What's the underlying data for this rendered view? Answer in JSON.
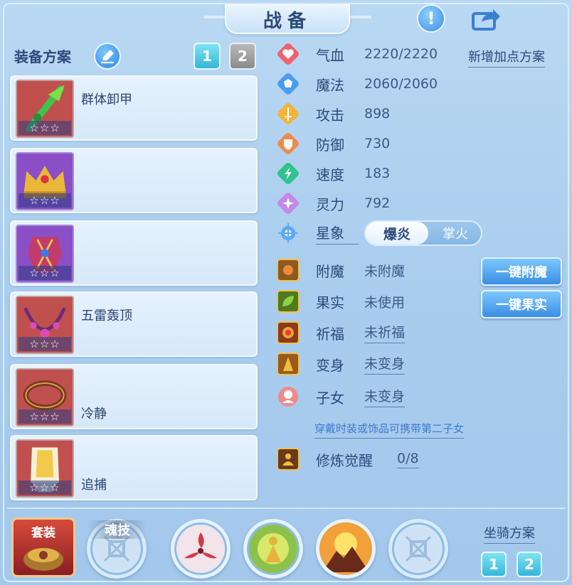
{
  "title": "战备",
  "left": {
    "plan_label": "装备方案",
    "plan_tabs": [
      "1",
      "2"
    ],
    "slots": [
      {
        "name": "群体卸甲",
        "stars": "☆☆☆"
      },
      {
        "name": "",
        "stars": "☆☆☆"
      },
      {
        "name": "",
        "stars": "☆☆☆"
      },
      {
        "name": "五雷轰顶",
        "stars": "☆☆☆"
      },
      {
        "name": "冷静",
        "stars": "☆☆☆"
      },
      {
        "name": "追捕",
        "stars": "☆☆☆"
      }
    ]
  },
  "stats": {
    "add_plan": "新增加点方案",
    "items": [
      {
        "label": "气血",
        "value": "2220/2220",
        "icon": "heart-icon",
        "color": "#f0626e"
      },
      {
        "label": "魔法",
        "value": "2060/2060",
        "icon": "mana-icon",
        "color": "#4a9cf0"
      },
      {
        "label": "攻击",
        "value": "898",
        "icon": "sword-icon",
        "color": "#f2b43a"
      },
      {
        "label": "防御",
        "value": "730",
        "icon": "shield-icon",
        "color": "#f08a4a"
      },
      {
        "label": "速度",
        "value": "183",
        "icon": "speed-icon",
        "color": "#2ec48a"
      },
      {
        "label": "灵力",
        "value": "792",
        "icon": "spirit-icon",
        "color": "#c489e8"
      }
    ],
    "star_label": "星象",
    "star_on": "爆炎",
    "star_off": "掌火"
  },
  "extras": [
    {
      "label": "附魔",
      "value": "未附魔"
    },
    {
      "label": "果实",
      "value": "未使用"
    },
    {
      "label": "祈福",
      "value": "未祈福"
    },
    {
      "label": "变身",
      "value": "未变身"
    },
    {
      "label": "子女",
      "value": "未变身"
    }
  ],
  "actions": {
    "enchant": "一键附魔",
    "fruit": "一键果实"
  },
  "hint": "穿戴时装或饰品可携带第二子女",
  "cultivation": {
    "label": "修炼觉醒",
    "value": "0/8"
  },
  "bottom": {
    "suit": "套装",
    "soul": "魂技",
    "mount_label": "坐骑方案",
    "mount_tabs": [
      "1",
      "2"
    ]
  }
}
